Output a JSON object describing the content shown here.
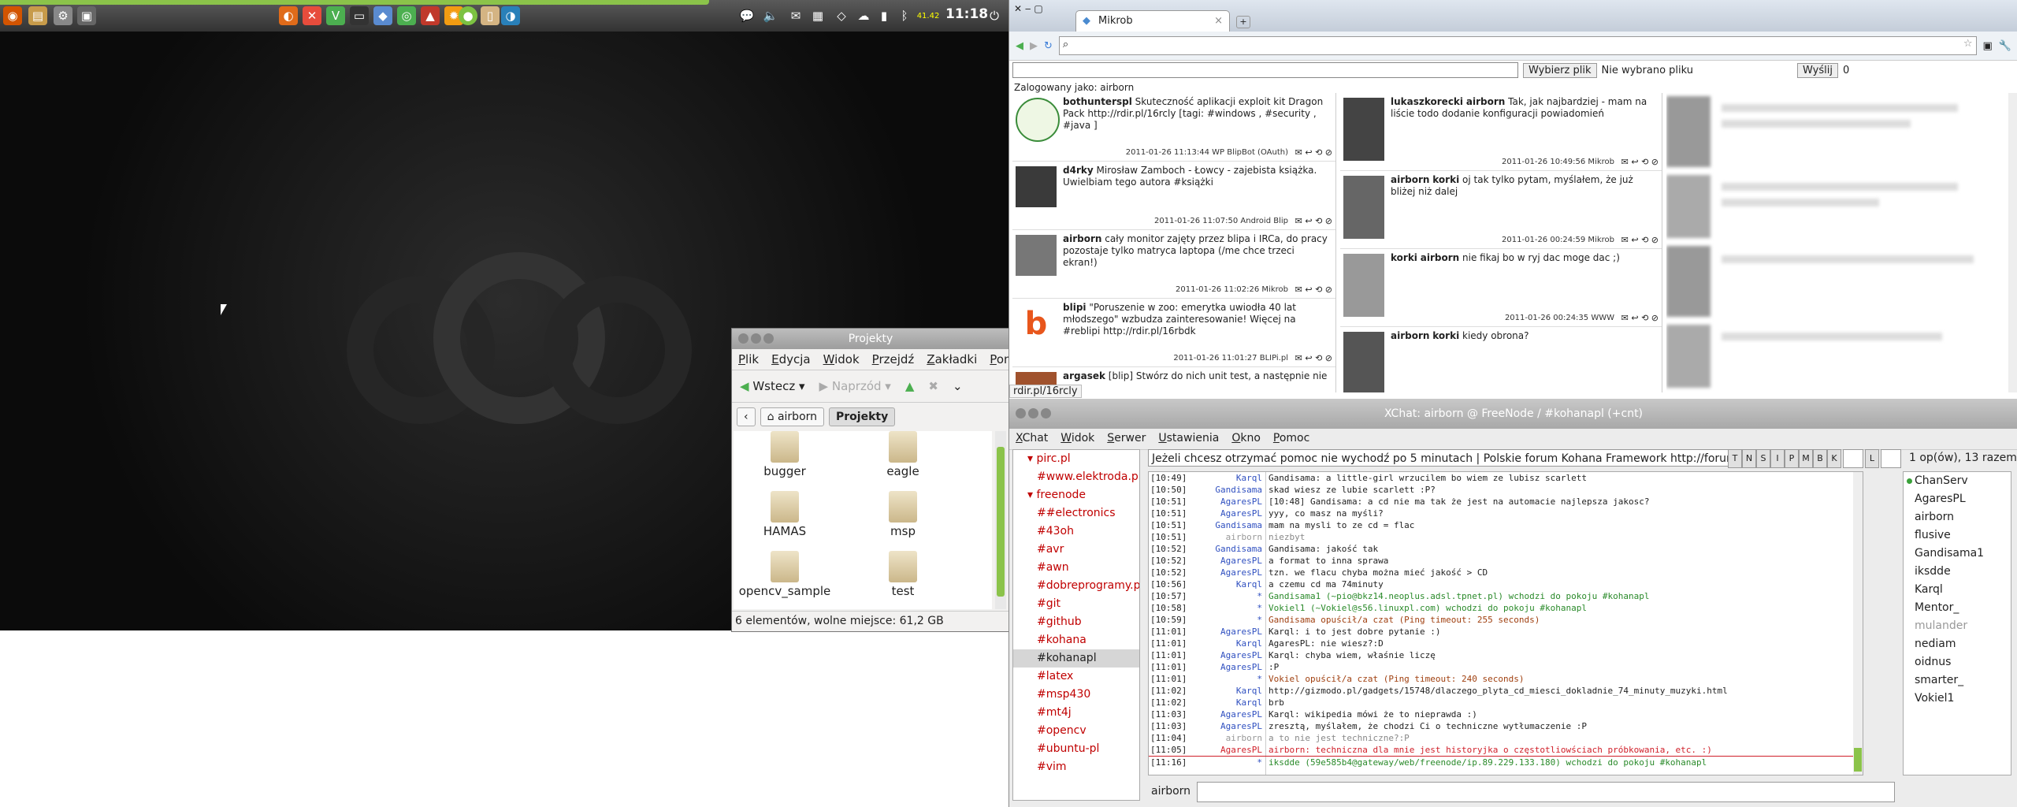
{
  "panel": {
    "clock": "11:18",
    "cpu_temp": "41.42"
  },
  "file_manager": {
    "title": "Projekty",
    "menu": [
      "Plik",
      "Edycja",
      "Widok",
      "Przejdź",
      "Zakładki",
      "Pomo"
    ],
    "back": "Wstecz",
    "forward": "Naprzód",
    "crumbs": [
      "airborn",
      "Projekty"
    ],
    "folders": [
      "bugger",
      "eagle",
      "HAMAS",
      "msp",
      "opencv_sample",
      "test"
    ],
    "status": "6 elementów, wolne miejsce: 61,2 GB"
  },
  "browser": {
    "tab_title": "Mikrob",
    "url": "",
    "choose_file": "Wybierz plik",
    "no_file": "Nie wybrano pliku",
    "send": "Wyślij",
    "counter": "0",
    "logged_as": "Zalogowany jako: airborn",
    "status_url": "rdir.pl/16rcly",
    "left_posts": [
      {
        "user": "bothunterspl",
        "text": "Skuteczność aplikacji exploit kit Dragon Pack http://rdir.pl/16rcly [tagi: #windows , #security , #java ]",
        "meta": "2011-01-26 11:13:44 WP BlipBot (OAuth)"
      },
      {
        "user": "d4rky",
        "text": "Mirosław Zamboch - Łowcy - zajebista książka. Uwielbiam tego autora #książki",
        "meta": "2011-01-26 11:07:50 Android Blip"
      },
      {
        "user": "airborn",
        "text": "cały monitor zajęty przez blipa i IRCa, do pracy pozostaje tylko matryca laptopa (/me chce trzeci ekran!)",
        "meta": "2011-01-26 11:02:26 Mikrob"
      },
      {
        "user": "blipi",
        "text": "\"Poruszenie w zoo: emerytka uwiodła 40 lat młodszego\" wzbudza zainteresowanie! Więcej na #reblipi http://rdir.pl/16rbdk",
        "meta": "2011-01-26 11:01:27 BLIPi.pl"
      },
      {
        "user": "argasek",
        "text": "[blip] Stwórz do nich unit test, a następnie nie",
        "meta": ""
      }
    ],
    "mid_posts": [
      {
        "user": "lukaszkorecki",
        "to": "airborn",
        "text": "Tak, jak najbardziej - mam na liście todo dodanie konfiguracji powiadomień",
        "meta": "2011-01-26 10:49:56 Mikrob"
      },
      {
        "user": "airborn",
        "to": "korki",
        "text": "oj tak tylko pytam, myślałem, że już bliżej niż dalej",
        "meta": "2011-01-26 00:24:59 Mikrob"
      },
      {
        "user": "korki",
        "to": "airborn",
        "text": "nie fikaj bo w ryj dac moge dac ;)",
        "meta": "2011-01-26 00:24:35 WWW"
      },
      {
        "user": "airborn",
        "to": "korki",
        "text": "kiedy obrona?",
        "meta": ""
      }
    ]
  },
  "xchat": {
    "title": "XChat: airborn @ FreeNode / #kohanapl (+cnt)",
    "menu": [
      "XChat",
      "Widok",
      "Serwer",
      "Ustawienia",
      "Okno",
      "Pomoc"
    ],
    "servers": [
      {
        "name": "pirc.pl",
        "channels": [
          "#www.elektroda.pl"
        ]
      },
      {
        "name": "freenode",
        "channels": [
          "##electronics",
          "#43oh",
          "#avr",
          "#awn",
          "#dobreprogramy.pl",
          "#git",
          "#github",
          "#kohana",
          "#kohanapl",
          "#latex",
          "#msp430",
          "#mt4j",
          "#opencv",
          "#ubuntu-pl",
          "#vim"
        ]
      }
    ],
    "selected_channel": "#kohanapl",
    "topic": "Jeżeli chcesz otrzymać pomoc nie wychodź po 5 minutach | Polskie forum Kohana Framework http://forum.ko",
    "mode_buttons": [
      "T",
      "N",
      "S",
      "I",
      "P",
      "M",
      "B",
      "K",
      "L"
    ],
    "user_count": "1 op(ów), 13 razem",
    "messages": [
      {
        "t": "[10:49]",
        "n": "Karql",
        "m": "Gandisama: a little-girl wrzucilem bo wiem ze lubisz scarlett"
      },
      {
        "t": "[10:50]",
        "n": "Gandisama",
        "m": "skad wiesz ze lubie scarlett :P?"
      },
      {
        "t": "[10:51]",
        "n": "AgaresPL",
        "m": "[10:48] Gandisama: a cd nie ma tak że jest na automacie najlepsza jakosc?"
      },
      {
        "t": "[10:51]",
        "n": "AgaresPL",
        "m": "yyy, co masz na myśli?"
      },
      {
        "t": "[10:51]",
        "n": "Gandisama",
        "m": "mam na mysli to ze cd = flac"
      },
      {
        "t": "[10:51]",
        "n": "airborn",
        "m": "niezbyt"
      },
      {
        "t": "[10:52]",
        "n": "Gandisama",
        "m": "Gandisama: jakość tak"
      },
      {
        "t": "[10:52]",
        "n": "AgaresPL",
        "m": "a format to inna sprawa"
      },
      {
        "t": "[10:52]",
        "n": "AgaresPL",
        "m": "tzn. we flacu chyba można mieć jakość > CD"
      },
      {
        "t": "[10:56]",
        "n": "Karql",
        "m": "a czemu cd ma 74minuty"
      },
      {
        "t": "[10:57]",
        "n": "*",
        "m": "Gandisama1 (~pio@bkz14.neoplus.adsl.tpnet.pl) wchodzi do pokoju #kohanapl"
      },
      {
        "t": "[10:58]",
        "n": "*",
        "m": "Vokiel1 (~Vokiel@s56.linuxpl.com) wchodzi do pokoju #kohanapl"
      },
      {
        "t": "[10:59]",
        "n": "*",
        "m": "Gandisama opuścił/a czat (Ping timeout: 255 seconds)"
      },
      {
        "t": "[11:01]",
        "n": "AgaresPL",
        "m": "Karql: i to jest dobre pytanie :)"
      },
      {
        "t": "[11:01]",
        "n": "Karql",
        "m": "AgaresPL: nie wiesz?:D"
      },
      {
        "t": "[11:01]",
        "n": "AgaresPL",
        "m": "Karql: chyba wiem, właśnie liczę"
      },
      {
        "t": "[11:01]",
        "n": "AgaresPL",
        "m": ":P"
      },
      {
        "t": "[11:01]",
        "n": "*",
        "m": "Vokiel opuścił/a czat (Ping timeout: 240 seconds)"
      },
      {
        "t": "[11:02]",
        "n": "Karql",
        "m": "http://gizmodo.pl/gadgets/15748/dlaczego_plyta_cd_miesci_dokladnie_74_minuty_muzyki.html"
      },
      {
        "t": "[11:02]",
        "n": "Karql",
        "m": "brb"
      },
      {
        "t": "[11:03]",
        "n": "AgaresPL",
        "m": "Karql: wikipedia mówi że to nieprawda :)"
      },
      {
        "t": "[11:03]",
        "n": "AgaresPL",
        "m": "zresztą, myślałem, że chodzi Ci o techniczne wytłumaczenie :P"
      },
      {
        "t": "[11:04]",
        "n": "airborn",
        "m": "a to nie jest techniczne?:P"
      },
      {
        "t": "[11:05]",
        "n": "AgaresPL",
        "m": "airborn: techniczna dla mnie jest historyjka o częstotliowściach próbkowania, etc. :)"
      },
      {
        "t": "[11:16]",
        "n": "*",
        "m": "iksdde (59e585b4@gateway/web/freenode/ip.89.229.133.180) wchodzi do pokoju #kohanapl"
      }
    ],
    "users": [
      "ChanServ",
      "AgaresPL",
      "airborn",
      "flusive",
      "Gandisama1",
      "iksdde",
      "Karql",
      "Mentor_",
      "mulander",
      "nediam",
      "oidnus",
      "smarter_",
      "Vokiel1"
    ],
    "nick": "airborn"
  },
  "colors": {
    "accent_green": "#8bc34a",
    "channel_red": "#c00000",
    "nick_blue": "#3050c0"
  }
}
